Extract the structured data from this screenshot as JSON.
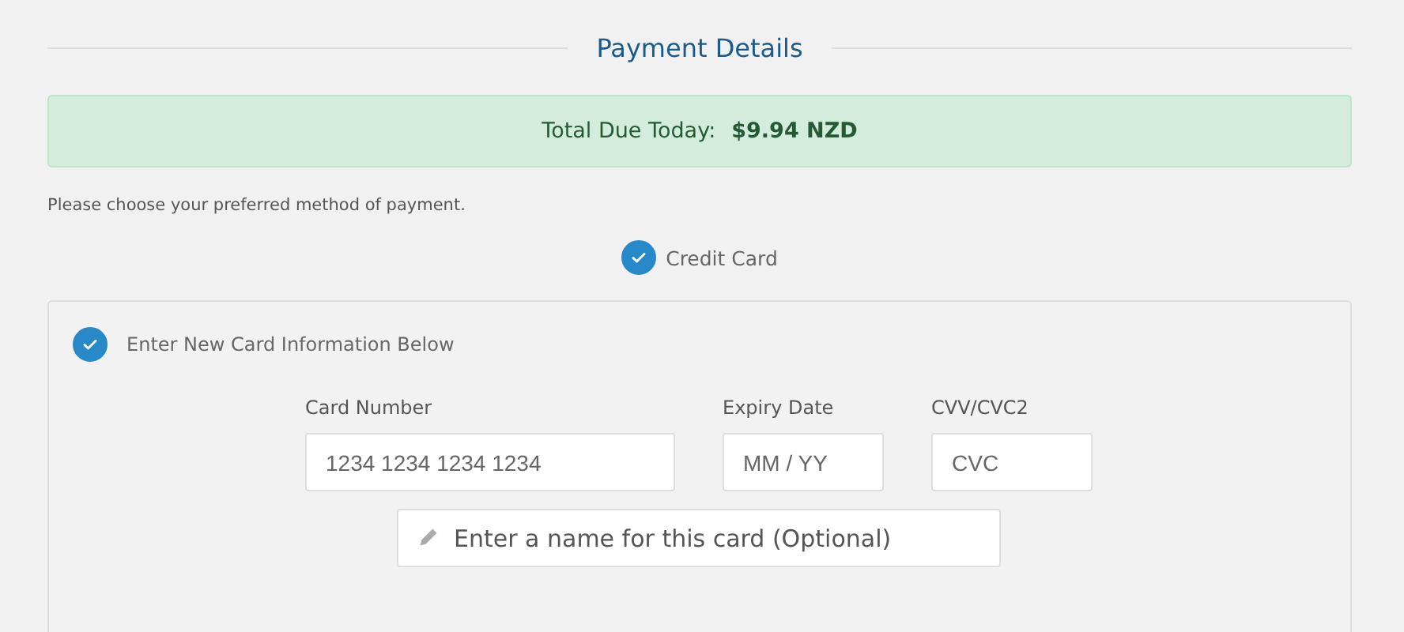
{
  "section_title": "Payment Details",
  "total": {
    "label": "Total Due Today:",
    "amount": "$9.94 NZD"
  },
  "instruction": "Please choose your preferred method of payment.",
  "payment_methods": [
    {
      "label": "Credit Card",
      "selected": true
    }
  ],
  "card_panel": {
    "option": {
      "label": "Enter New Card Information Below",
      "checked": true
    },
    "fields": [
      {
        "label": "Card Number",
        "placeholder": "1234 1234 1234 1234",
        "kind": "wide"
      },
      {
        "label": "Expiry Date",
        "placeholder": "MM / YY",
        "kind": "narrow"
      },
      {
        "label": "CVV/CVC2",
        "placeholder": "CVC",
        "kind": "narrow"
      }
    ],
    "name_field": {
      "placeholder": "Enter a name for this card (Optional)"
    }
  }
}
